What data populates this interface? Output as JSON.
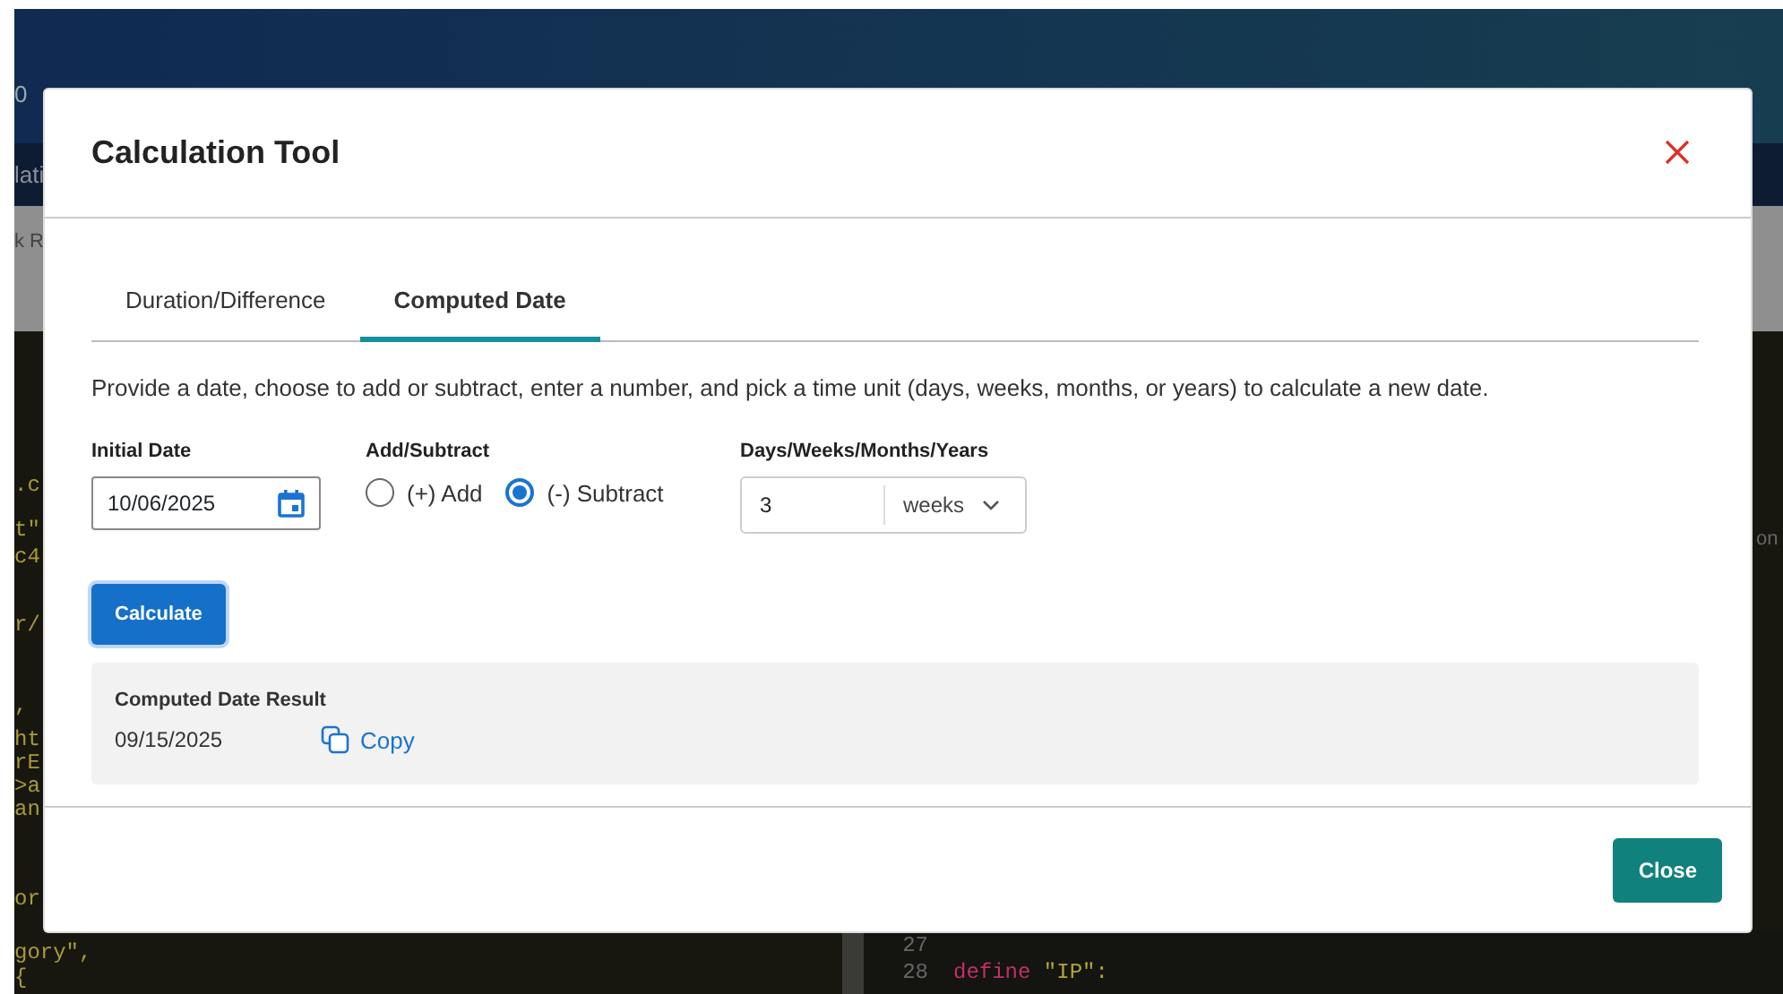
{
  "background": {
    "header_text": "0",
    "nav_text": "lati",
    "toolbar_text": "k R",
    "left_fragments": [
      ".c",
      "t\"",
      "c4",
      "r/",
      ",",
      "ht",
      "rE",
      ">a",
      "an",
      "or",
      "gory\",",
      "{"
    ],
    "right_fragments": [
      "on"
    ],
    "code_lines": [
      {
        "number": "27"
      },
      {
        "number": "28",
        "tokens": [
          {
            "text": "define",
            "kind": "keyword"
          },
          {
            "text": "\"IP\":",
            "kind": "string"
          }
        ]
      }
    ]
  },
  "modal": {
    "title": "Calculation Tool",
    "tabs": [
      {
        "label": "Duration/Difference",
        "selected": false
      },
      {
        "label": "Computed Date",
        "selected": true
      }
    ],
    "description": "Provide a date, choose to add or subtract, enter a number, and pick a time unit (days, weeks, months, or years) to calculate a new date.",
    "initial_date": {
      "label": "Initial Date",
      "value": "10/06/2025"
    },
    "operation": {
      "label": "Add/Subtract",
      "options": [
        {
          "label": "(+) Add",
          "selected": false
        },
        {
          "label": "(-) Subtract",
          "selected": true
        }
      ]
    },
    "amount": {
      "label": "Days/Weeks/Months/Years",
      "value": "3",
      "unit": "weeks"
    },
    "calculate_button": "Calculate",
    "result": {
      "label": "Computed Date Result",
      "value": "09/15/2025",
      "copy": "Copy"
    },
    "close_button": "Close"
  }
}
